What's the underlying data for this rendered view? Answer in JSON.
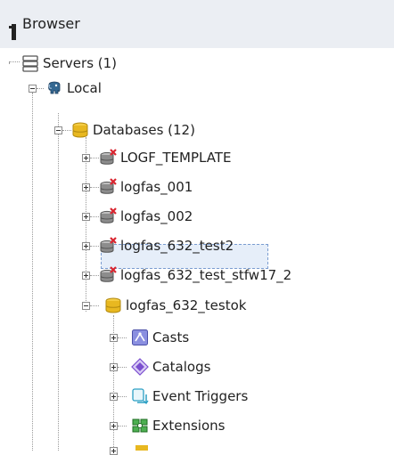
{
  "header": {
    "title": "Browser",
    "icon": "browser-tree-icon"
  },
  "tree": {
    "servers": {
      "label": "Servers (1)",
      "icon": "servers-icon"
    },
    "local": {
      "label": "Local",
      "icon": "elephant-server-icon"
    },
    "databases": {
      "label": "Databases (12)",
      "icon": "databases-icon"
    },
    "db_items": [
      {
        "label": "LOGF_TEMPLATE",
        "icon": "database-disconnected-icon"
      },
      {
        "label": "logfas_001",
        "icon": "database-disconnected-icon"
      },
      {
        "label": "logfas_002",
        "icon": "database-disconnected-icon"
      },
      {
        "label": "logfas_632_test2",
        "icon": "database-disconnected-icon"
      },
      {
        "label": "logfas_632_test_stfw17_2",
        "icon": "database-disconnected-icon"
      },
      {
        "label": "logfas_632_testok",
        "icon": "database-connected-icon"
      }
    ],
    "children": [
      {
        "label": "Casts",
        "icon": "casts-icon"
      },
      {
        "label": "Catalogs",
        "icon": "catalogs-icon"
      },
      {
        "label": "Event Triggers",
        "icon": "event-triggers-icon"
      },
      {
        "label": "Extensions",
        "icon": "extensions-icon"
      }
    ]
  },
  "colors": {
    "header_bg": "#ebeef3",
    "selection_bg": "#e6eef9",
    "database_gold": "#e8b820",
    "disconnected_x": "#d9232e",
    "elephant_blue": "#336791"
  }
}
